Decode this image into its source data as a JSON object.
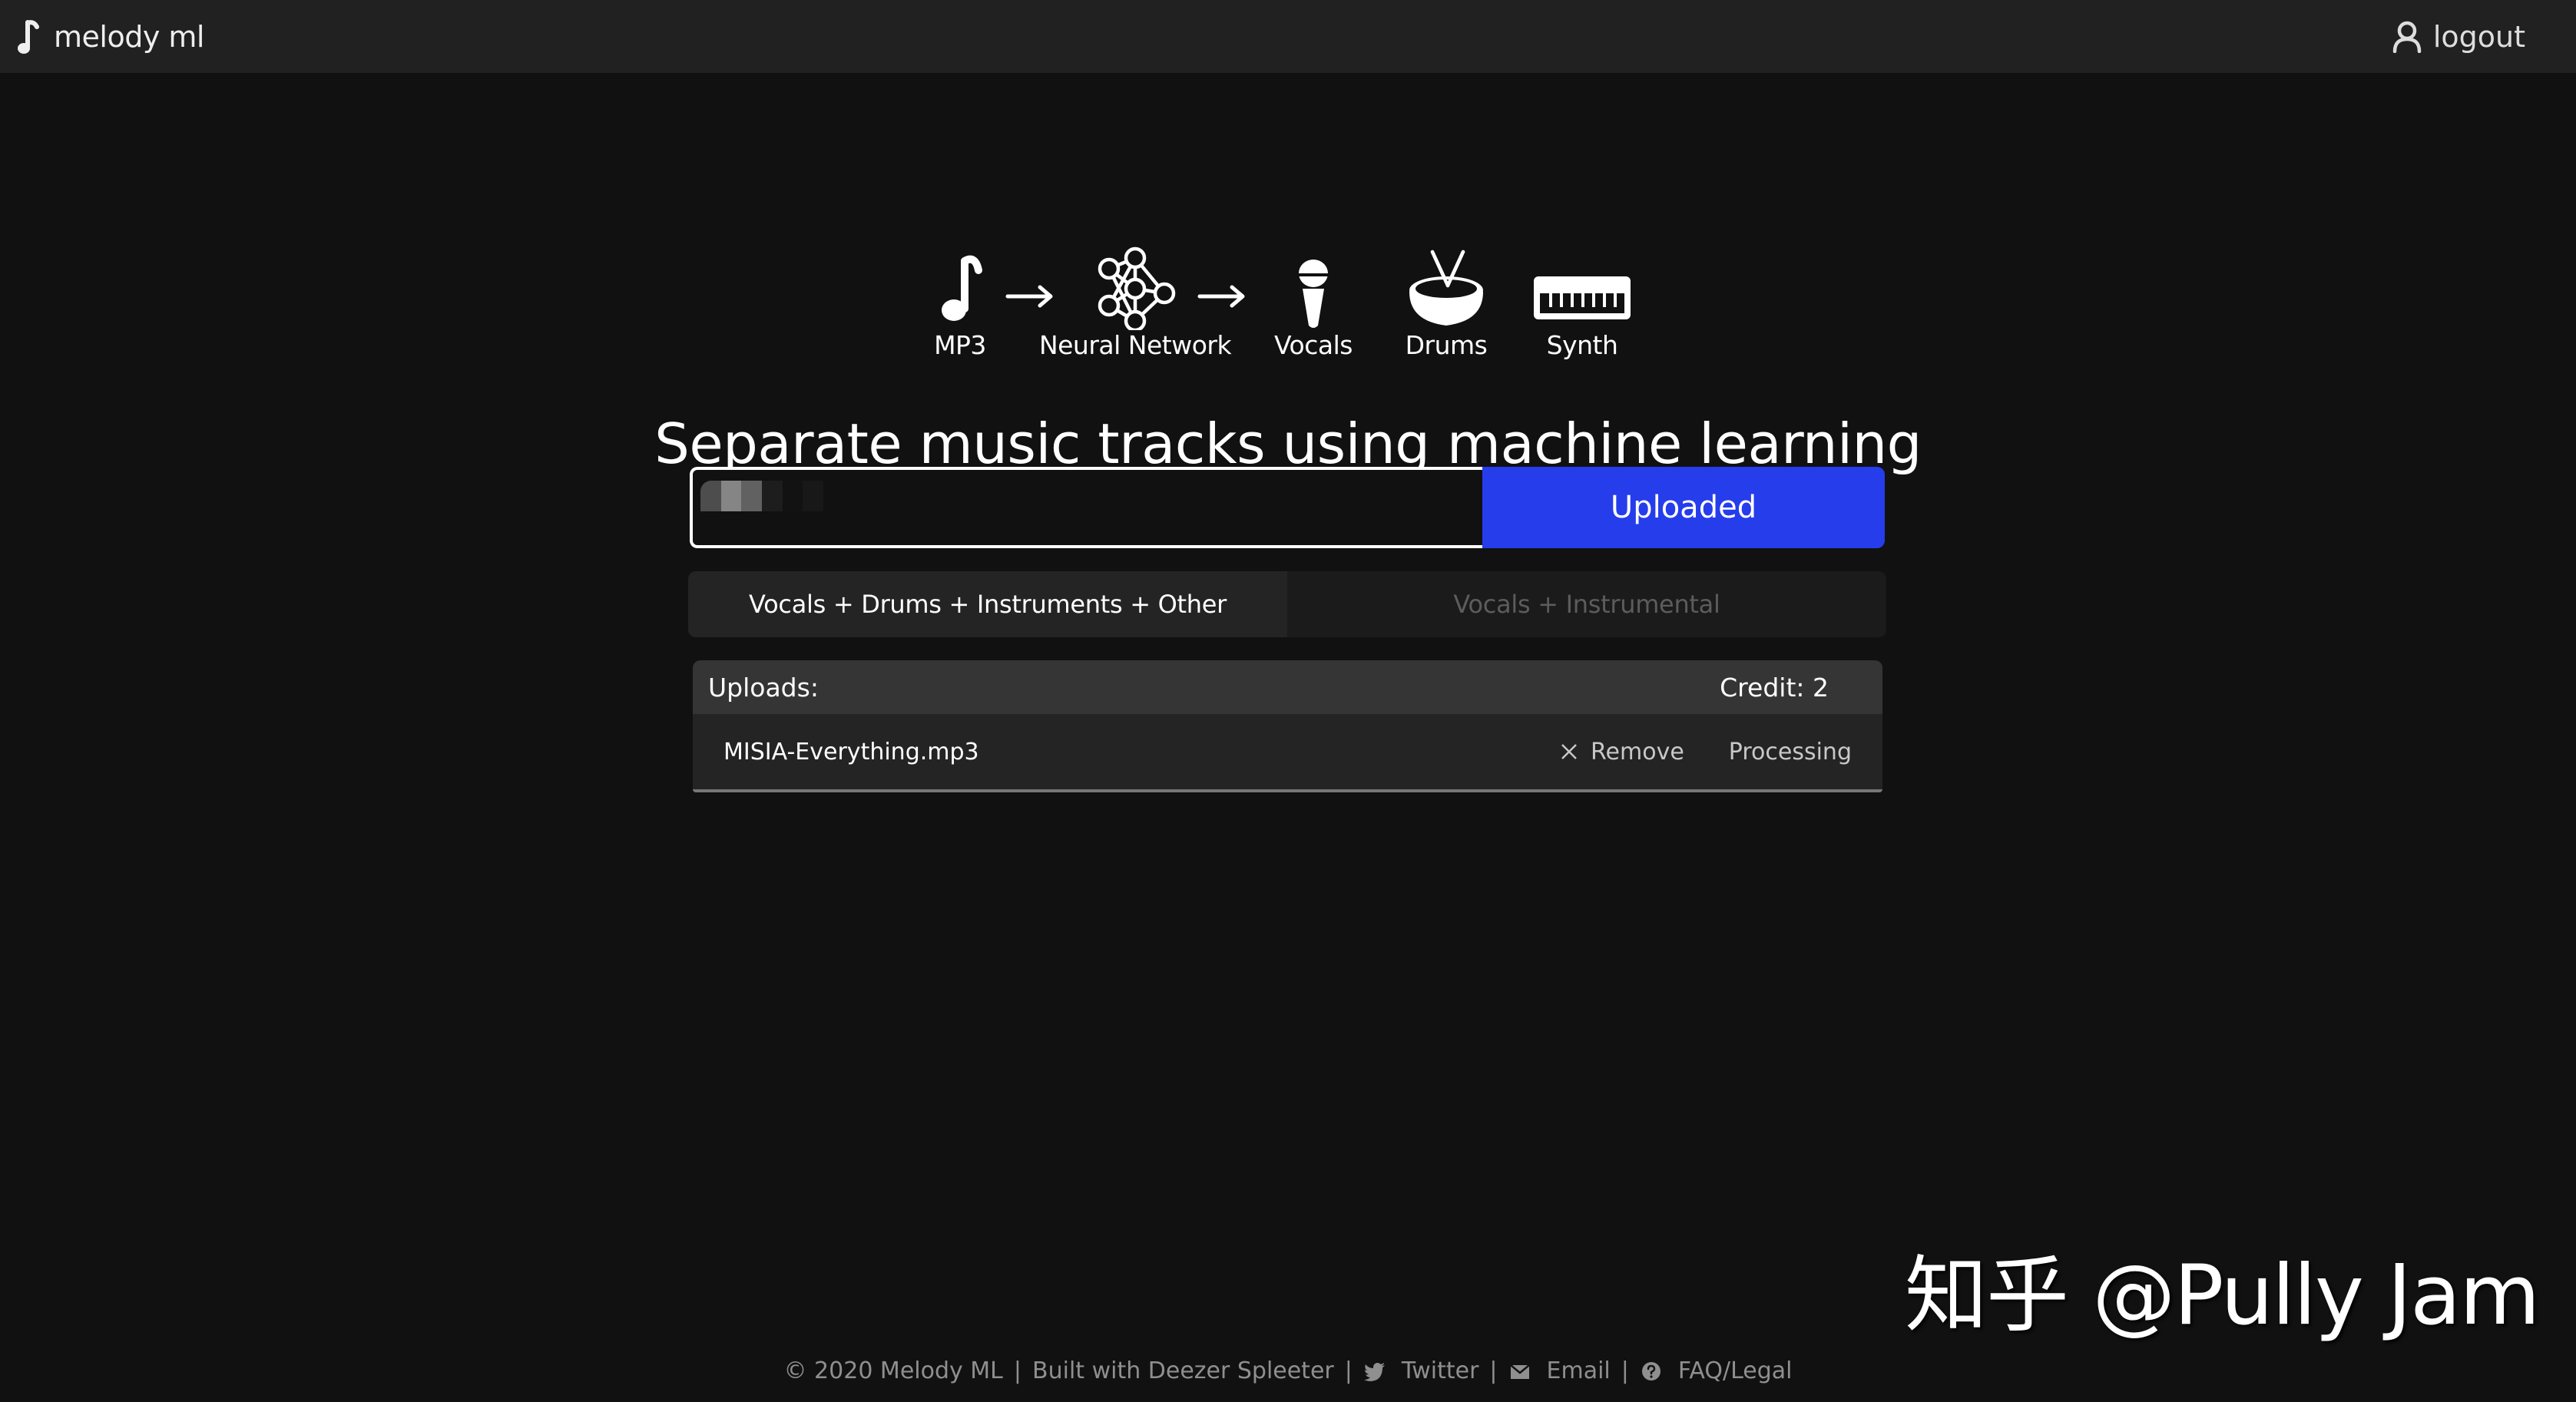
{
  "header": {
    "brand": "melody ml",
    "brand_icon": "music-note-icon",
    "logout_label": "logout",
    "logout_icon": "user-icon"
  },
  "pipeline": [
    {
      "label": "MP3",
      "icon": "music-note-icon"
    },
    {
      "label": "Neural Network",
      "icon": "neural-network-icon"
    },
    {
      "label": "Vocals",
      "icon": "microphone-icon"
    },
    {
      "label": "Drums",
      "icon": "drum-icon"
    },
    {
      "label": "Synth",
      "icon": "keyboard-icon"
    }
  ],
  "title": "Separate music tracks using machine learning",
  "uploader": {
    "file_value": "",
    "button_label": "Uploaded",
    "accent_color": "#263dec"
  },
  "modes": {
    "tabs": [
      {
        "label": "Vocals + Drums + Instruments + Other",
        "active": true
      },
      {
        "label": "Vocals + Instrumental",
        "active": false
      }
    ]
  },
  "uploads": {
    "title": "Uploads:",
    "credit": "Credit: 2",
    "items": [
      {
        "file": "MISIA-Everything.mp3",
        "remove_label": "Remove",
        "status": "Processing"
      }
    ]
  },
  "footer": {
    "copyright": "© 2020 Melody ML",
    "built_with": "Built with Deezer Spleeter",
    "links": [
      {
        "label": "Twitter",
        "icon": "twitter-icon"
      },
      {
        "label": "Email",
        "icon": "email-icon"
      },
      {
        "label": "FAQ/Legal",
        "icon": "question-icon"
      }
    ],
    "separator": "|"
  },
  "watermark": "知乎 @Pully Jam"
}
